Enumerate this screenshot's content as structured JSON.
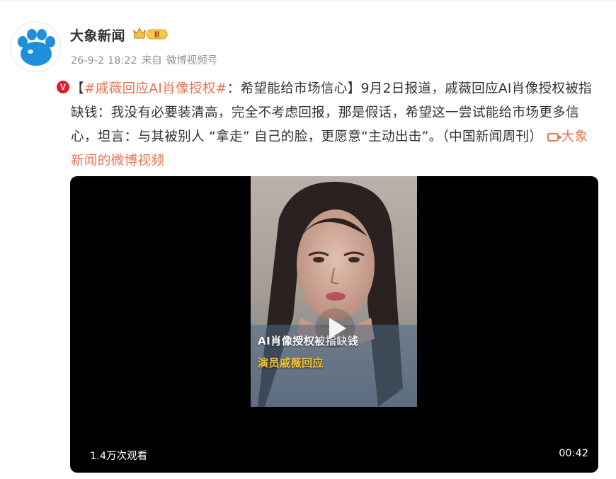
{
  "post": {
    "username": "大象新闻",
    "vip_level": "Ⅲ",
    "verified_mark": "V",
    "time": "26-9-2 18:22",
    "source_prefix": "来自",
    "source": "微博视频号",
    "text": {
      "open_bracket": "【",
      "hashtag": "#戚薇回应AI肖像授权#",
      "headline": "：希望能给市场信心】",
      "body": "9月2日报道，戚薇回应AI肖像授权被指缺钱：我没有必要装清高，完全不考虑回报，那是假话，希望这一尝试能给市场更多信心，坦言：与其被别人 “拿走” 自己的脸，更愿意“主动出击”。（中国新闻周刊）",
      "video_link": "大象新闻的微博视频"
    }
  },
  "video": {
    "caption_line1": "AI肖像授权被指缺钱",
    "caption_line2": "演员戚薇回应",
    "views": "1.4万次观看",
    "duration": "00:42"
  },
  "icons": {
    "avatar": "elephant-paw-logo",
    "vip": "crown-vip-badge",
    "play": "play-icon",
    "video_link": "video-camera-icon"
  },
  "colors": {
    "link": "#eb7350",
    "brand_avatar": "#1e8fdc",
    "verified": "#e6162d",
    "caption_yellow": "#f4c430"
  }
}
